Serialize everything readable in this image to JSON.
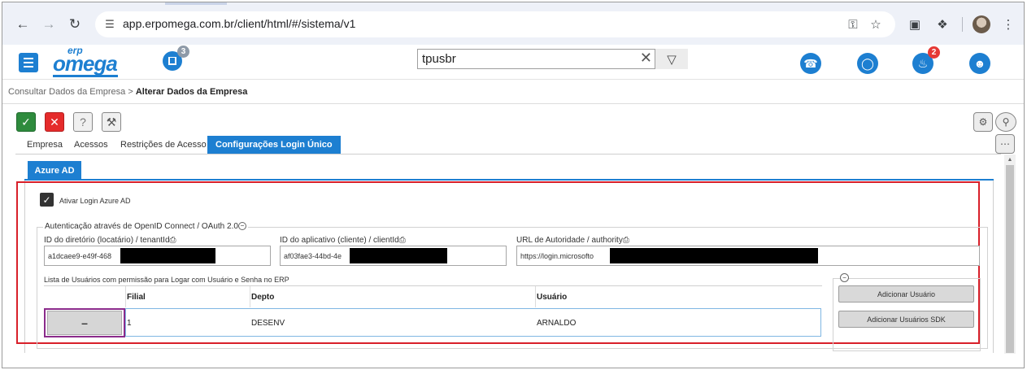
{
  "browser": {
    "url": "app.erpomega.com.br/client/html/#/sistema/v1"
  },
  "app": {
    "logo_top": "erp",
    "logo_main": "omega",
    "notification_badge": "3",
    "alerts_badge": "2",
    "search": {
      "value": "tpusbr"
    }
  },
  "breadcrumb": {
    "parent": "Consultar Dados da Empresa",
    "separator": ">",
    "current": "Alterar Dados da Empresa"
  },
  "tabs": [
    {
      "label": "Empresa"
    },
    {
      "label": "Acessos"
    },
    {
      "label": "Restrições de Acesso"
    },
    {
      "label": "Configurações Login Único"
    }
  ],
  "subtab": {
    "label": "Azure AD"
  },
  "form": {
    "enable_label": "Ativar Login Azure AD",
    "section_title": "Autenticação através de OpenID Connect / OAuth 2.0",
    "tenant": {
      "label": "ID do diretório (locatário) / tenantId",
      "value": "a1dcaee9-e49f-468"
    },
    "client": {
      "label": "ID do aplicativo (cliente) / clientId",
      "value": "af03fae3-44bd-4e"
    },
    "authority": {
      "label": "URL de Autoridade / authority",
      "value": "https://login.microsofto"
    },
    "users_list_label": "Lista de Usuários com permissão para Logar com Usuário e Senha no ERP"
  },
  "grid": {
    "columns": [
      "Filial",
      "Depto",
      "Usuário"
    ],
    "rows": [
      {
        "remove_label": "–",
        "filial": "1",
        "depto": "DESENV",
        "usuario": "ARNALDO"
      }
    ]
  },
  "actions": {
    "add_user": "Adicionar Usuário",
    "add_sdk_users": "Adicionar Usuários SDK"
  },
  "colors": {
    "accent": "#1d7fd1",
    "highlight": "#d8202a",
    "ok": "#2e8b3d",
    "cancel": "#e52b2b"
  }
}
